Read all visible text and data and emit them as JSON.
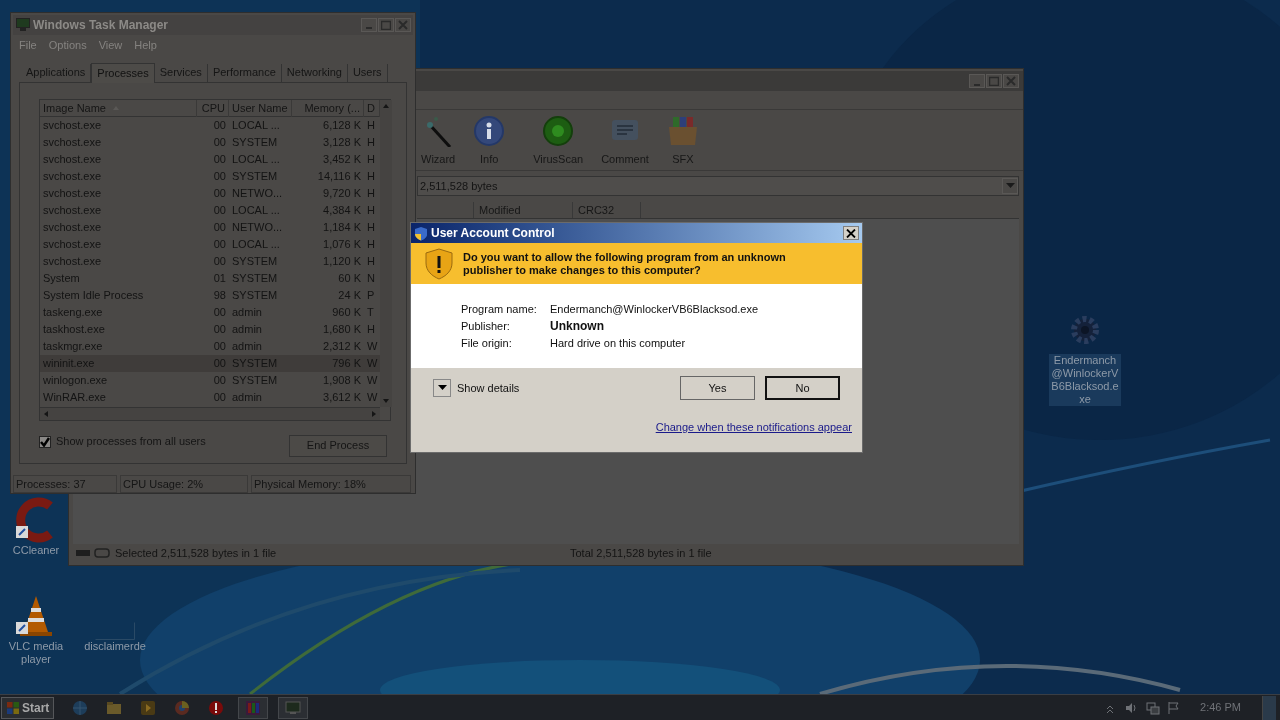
{
  "task_manager": {
    "title": "Windows Task Manager",
    "menu": [
      "File",
      "Options",
      "View",
      "Help"
    ],
    "tabs": [
      {
        "label": "Applications",
        "selected": false
      },
      {
        "label": "Processes",
        "selected": true
      },
      {
        "label": "Services",
        "selected": false
      },
      {
        "label": "Performance",
        "selected": false
      },
      {
        "label": "Networking",
        "selected": false
      },
      {
        "label": "Users",
        "selected": false
      }
    ],
    "columns": [
      "Image Name",
      "CPU",
      "User Name",
      "Memory (...",
      "D"
    ],
    "rows": [
      {
        "cells": [
          "svchost.exe",
          "00",
          "LOCAL ...",
          "6,128 K",
          "H"
        ],
        "selected": false
      },
      {
        "cells": [
          "svchost.exe",
          "00",
          "SYSTEM",
          "3,128 K",
          "H"
        ],
        "selected": false
      },
      {
        "cells": [
          "svchost.exe",
          "00",
          "LOCAL ...",
          "3,452 K",
          "H"
        ],
        "selected": false
      },
      {
        "cells": [
          "svchost.exe",
          "00",
          "SYSTEM",
          "14,116 K",
          "H"
        ],
        "selected": false
      },
      {
        "cells": [
          "svchost.exe",
          "00",
          "NETWO...",
          "9,720 K",
          "H"
        ],
        "selected": false
      },
      {
        "cells": [
          "svchost.exe",
          "00",
          "LOCAL ...",
          "4,384 K",
          "H"
        ],
        "selected": false
      },
      {
        "cells": [
          "svchost.exe",
          "00",
          "NETWO...",
          "1,184 K",
          "H"
        ],
        "selected": false
      },
      {
        "cells": [
          "svchost.exe",
          "00",
          "LOCAL ...",
          "1,076 K",
          "H"
        ],
        "selected": false
      },
      {
        "cells": [
          "svchost.exe",
          "00",
          "SYSTEM",
          "1,120 K",
          "H"
        ],
        "selected": false
      },
      {
        "cells": [
          "System",
          "01",
          "SYSTEM",
          "60 K",
          "N"
        ],
        "selected": false
      },
      {
        "cells": [
          "System Idle Process",
          "98",
          "SYSTEM",
          "24 K",
          "P"
        ],
        "selected": false
      },
      {
        "cells": [
          "taskeng.exe",
          "00",
          "admin",
          "960 K",
          "T"
        ],
        "selected": false
      },
      {
        "cells": [
          "taskhost.exe",
          "00",
          "admin",
          "1,680 K",
          "H"
        ],
        "selected": false
      },
      {
        "cells": [
          "taskmgr.exe",
          "00",
          "admin",
          "2,312 K",
          "W"
        ],
        "selected": false
      },
      {
        "cells": [
          "wininit.exe",
          "00",
          "SYSTEM",
          "796 K",
          "W"
        ],
        "selected": true
      },
      {
        "cells": [
          "winlogon.exe",
          "00",
          "SYSTEM",
          "1,908 K",
          "W"
        ],
        "selected": false
      },
      {
        "cells": [
          "WinRAR.exe",
          "00",
          "admin",
          "3,612 K",
          "W"
        ],
        "selected": false
      }
    ],
    "show_all_users": {
      "label": "Show processes from all users",
      "checked": true
    },
    "end_process": "End Process",
    "status_bar": [
      "Processes: 37",
      "CPU Usage: 2%",
      "Physical Memory: 18%"
    ]
  },
  "winrar": {
    "toolbar": [
      {
        "kind": "wand",
        "label": "Wizard"
      },
      {
        "kind": "info",
        "label": "Info"
      },
      {
        "kind": "scan",
        "label": "VirusScan"
      },
      {
        "kind": "comment",
        "label": "Comment"
      },
      {
        "kind": "sfx",
        "label": "SFX"
      }
    ],
    "address": "2,511,528 bytes",
    "columns": [
      "Modified",
      "CRC32"
    ],
    "status_left": "Selected 2,511,528 bytes in 1 file",
    "status_right": "Total 2,511,528 bytes in 1 file"
  },
  "uac": {
    "title": "User Account Control",
    "question": "Do you want to allow the following program from an unknown publisher to make changes to this computer?",
    "details": [
      {
        "label": "Program name:",
        "value": "Endermanch@WinlockerVB6Blacksod.exe",
        "bold": false
      },
      {
        "label": "Publisher:",
        "value": "Unknown",
        "bold": true
      },
      {
        "label": "File origin:",
        "value": "Hard drive on this computer",
        "bold": false
      }
    ],
    "show_details": "Show details",
    "buttons": [
      "Yes",
      "No"
    ],
    "link": "Change when these notifications appear"
  },
  "desktop_icons": [
    {
      "kind": "ccleaner",
      "label": "CCleaner",
      "selected": false
    },
    {
      "kind": "vlc",
      "label": "VLC media player",
      "selected": false
    },
    {
      "kind": "blank",
      "label": "disclaimerde",
      "selected": false
    },
    {
      "kind": "exe",
      "label": "Endermanch@WinlockerVB6Blacksod.exe",
      "selected": true
    }
  ],
  "taskbar": {
    "start": "Start",
    "clock": "2:46 PM"
  }
}
